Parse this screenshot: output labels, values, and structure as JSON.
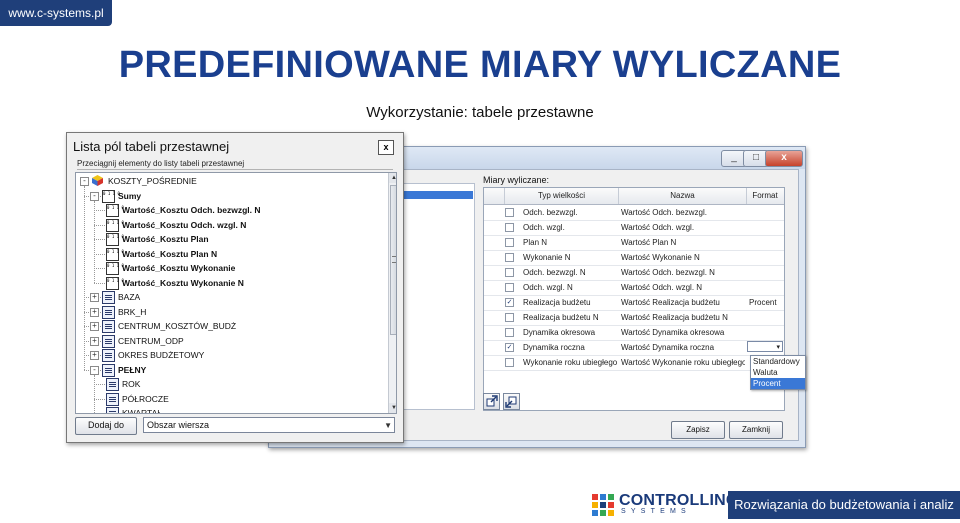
{
  "header": {
    "url": "www.c-systems.pl",
    "title": "PREDEFINIOWANE MIARY WYLICZANE",
    "subtitle": "Wykorzystanie: tabele przestawne"
  },
  "pivot_field_list": {
    "title": "Lista pól tabeli przestawnej",
    "close_label": "x",
    "instruction": "Przeciągnij elementy do listy tabeli przestawnej",
    "tree": [
      {
        "label": "KOSZTY_POŚREDNIE",
        "level": 0,
        "icon": "cube-icon",
        "expander": "-",
        "bold": false
      },
      {
        "label": "Sumy",
        "level": 1,
        "icon": "measure-icon",
        "expander": "-",
        "bold": true
      },
      {
        "label": "Wartość_Kosztu Odch. bezwzgl. N",
        "level": 2,
        "icon": "measure-icon",
        "expander": "",
        "bold": true
      },
      {
        "label": "Wartość_Kosztu Odch. wzgl. N",
        "level": 2,
        "icon": "measure-icon",
        "expander": "",
        "bold": true
      },
      {
        "label": "Wartość_Kosztu Plan",
        "level": 2,
        "icon": "measure-icon",
        "expander": "",
        "bold": true
      },
      {
        "label": "Wartość_Kosztu Plan N",
        "level": 2,
        "icon": "measure-icon",
        "expander": "",
        "bold": true
      },
      {
        "label": "Wartość_Kosztu Wykonanie",
        "level": 2,
        "icon": "measure-icon",
        "expander": "",
        "bold": true
      },
      {
        "label": "Wartość_Kosztu Wykonanie N",
        "level": 2,
        "icon": "measure-icon",
        "expander": "",
        "bold": true
      },
      {
        "label": "BAZA",
        "level": 1,
        "icon": "dimension-icon",
        "expander": "+",
        "bold": false
      },
      {
        "label": "BRK_H",
        "level": 1,
        "icon": "dimension-icon",
        "expander": "+",
        "bold": false
      },
      {
        "label": "CENTRUM_KOSZTÓW_BUDŻ",
        "level": 1,
        "icon": "dimension-icon",
        "expander": "+",
        "bold": false
      },
      {
        "label": "CENTRUM_ODP",
        "level": 1,
        "icon": "dimension-icon",
        "expander": "+",
        "bold": false
      },
      {
        "label": "OKRES BUDŻETOWY",
        "level": 1,
        "icon": "dimension-icon",
        "expander": "+",
        "bold": false
      },
      {
        "label": "PEŁNY",
        "level": 1,
        "icon": "dimension-icon",
        "expander": "-",
        "bold": true
      },
      {
        "label": "ROK",
        "level": 2,
        "icon": "dimension-icon",
        "expander": "",
        "bold": false
      },
      {
        "label": "PÓŁROCZE",
        "level": 2,
        "icon": "dimension-icon",
        "expander": "",
        "bold": false
      },
      {
        "label": "KWARTAŁ",
        "level": 2,
        "icon": "dimension-icon",
        "expander": "",
        "bold": false
      }
    ],
    "add_button": "Dodaj do",
    "area_select": "Obszar wiersza"
  },
  "measures_dialog": {
    "section_label": "Miary wyliczane:",
    "columns": [
      "Typ wielkości",
      "Nazwa",
      "Format"
    ],
    "rows": [
      {
        "checked": false,
        "type": "Odch. bezwzgl.",
        "name": "Wartość Odch. bezwzgl.",
        "format": ""
      },
      {
        "checked": false,
        "type": "Odch. wzgl.",
        "name": "Wartość Odch. wzgl.",
        "format": ""
      },
      {
        "checked": false,
        "type": "Plan N",
        "name": "Wartość Plan N",
        "format": ""
      },
      {
        "checked": false,
        "type": "Wykonanie N",
        "name": "Wartość Wykonanie N",
        "format": ""
      },
      {
        "checked": false,
        "type": "Odch. bezwzgl. N",
        "name": "Wartość Odch. bezwzgl. N",
        "format": ""
      },
      {
        "checked": false,
        "type": "Odch. wzgl. N",
        "name": "Wartość Odch. wzgl. N",
        "format": ""
      },
      {
        "checked": true,
        "type": "Realizacja budżetu",
        "name": "Wartość Realizacja budżetu",
        "format": "Procent"
      },
      {
        "checked": false,
        "type": "Realizacja budżetu N",
        "name": "Wartość Realizacja budżetu N",
        "format": ""
      },
      {
        "checked": false,
        "type": "Dynamika okresowa",
        "name": "Wartość Dynamika okresowa",
        "format": ""
      },
      {
        "checked": true,
        "type": "Dynamika roczna",
        "name": "Wartość Dynamika roczna",
        "format": ""
      },
      {
        "checked": false,
        "type": "Wykonanie roku ubiegłego",
        "name": "Wartość Wykonanie roku ubiegłego",
        "format": ""
      }
    ],
    "format_options": [
      "Standardowy",
      "Waluta",
      "Procent"
    ],
    "format_selected": "Procent",
    "save_button": "Zapisz",
    "close_button": "Zamknij",
    "window_buttons": [
      "_",
      "□",
      "x"
    ]
  },
  "footer": {
    "logo_name": "CONTROLLING",
    "logo_sub": "SYSTEMS",
    "tagline": "Rozwiązania do budżetowania i analiz"
  },
  "colors": {
    "brand_blue": "#1f3f7a",
    "title_blue": "#1a3f8f",
    "selection_blue": "#3a78d6"
  }
}
